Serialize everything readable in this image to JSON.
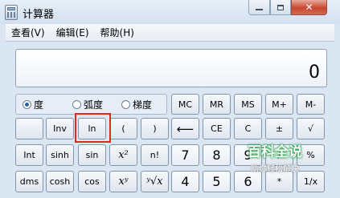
{
  "window": {
    "title": "计算器"
  },
  "menu": {
    "items": [
      "查看(V)",
      "编辑(E)",
      "帮助(H)"
    ]
  },
  "display": {
    "value": "0"
  },
  "angle_modes": [
    {
      "label": "度",
      "checked": true
    },
    {
      "label": "弧度",
      "checked": false
    },
    {
      "label": "梯度",
      "checked": false
    }
  ],
  "memory_buttons": [
    "MC",
    "MR",
    "MS",
    "M+",
    "M-"
  ],
  "row2": [
    "Inv",
    "ln",
    "(",
    ")",
    "⟵",
    "CE",
    "C",
    "±",
    "√"
  ],
  "row3": [
    "Int",
    "sinh",
    "sin",
    "x²",
    "n!",
    "7",
    "8",
    "9",
    "/",
    "%"
  ],
  "row4": [
    "dms",
    "cosh",
    "cos",
    "xʸ",
    "ʸ√x",
    "4",
    "5",
    "6",
    "*",
    "1/x"
  ],
  "watermark": {
    "logo": "百科全说",
    "subtitle": "助你轻松解决"
  }
}
